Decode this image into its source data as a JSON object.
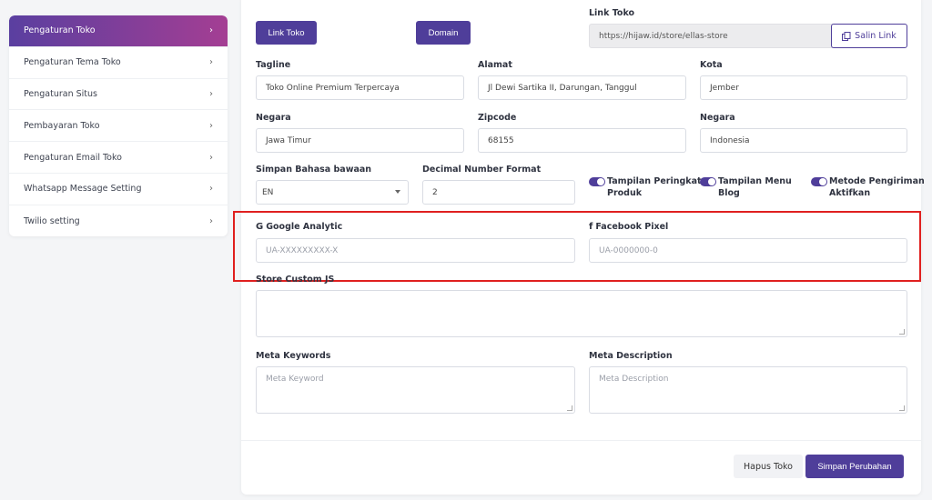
{
  "sidebar": {
    "items": [
      {
        "label": "Pengaturan Toko"
      },
      {
        "label": "Pengaturan Tema Toko"
      },
      {
        "label": "Pengaturan Situs"
      },
      {
        "label": "Pembayaran Toko"
      },
      {
        "label": "Pengaturan Email Toko"
      },
      {
        "label": "Whatsapp Message Setting"
      },
      {
        "label": "Twilio setting"
      }
    ]
  },
  "top": {
    "link_toko_button": "Link Toko",
    "domain_button": "Domain",
    "link_toko_label": "Link Toko",
    "link_toko_value": "https://hijaw.id/store/ellas-store",
    "copy_button": "Salin Link"
  },
  "fields": {
    "tagline_label": "Tagline",
    "tagline_value": "Toko Online Premium Terpercaya",
    "alamat_label": "Alamat",
    "alamat_value": "Jl Dewi Sartika II, Darungan, Tanggul",
    "kota_label": "Kota",
    "kota_value": "Jember",
    "negara1_label": "Negara",
    "negara1_value": "Jawa Timur",
    "zipcode_label": "Zipcode",
    "zipcode_value": "68155",
    "negara2_label": "Negara",
    "negara2_value": "Indonesia",
    "bahasa_label": "Simpan Bahasa bawaan",
    "bahasa_value": "EN",
    "decimal_label": "Decimal Number Format",
    "decimal_value": "2"
  },
  "toggles": [
    {
      "line1": "Tampilan Peringkat",
      "line2": "Produk",
      "on": true
    },
    {
      "line1": "Tampilan Menu",
      "line2": "Blog",
      "on": true
    },
    {
      "line1": "Metode Pengiriman",
      "line2": "Aktifkan",
      "on": true
    }
  ],
  "analytics": {
    "google_icon": "G",
    "google_label": "Google Analytic",
    "google_placeholder": "UA-XXXXXXXXX-X",
    "facebook_icon": "f",
    "facebook_label": "Facebook Pixel",
    "facebook_placeholder": "UA-0000000-0"
  },
  "custom_js_label": "Store Custom JS",
  "meta": {
    "keywords_label": "Meta Keywords",
    "keywords_placeholder": "Meta Keyword",
    "description_label": "Meta Description",
    "description_placeholder": "Meta Description"
  },
  "footer": {
    "delete_button": "Hapus Toko",
    "save_button": "Simpan Perubahan"
  },
  "colors": {
    "accent": "#4f3e9a",
    "highlight": "#e0201f"
  }
}
